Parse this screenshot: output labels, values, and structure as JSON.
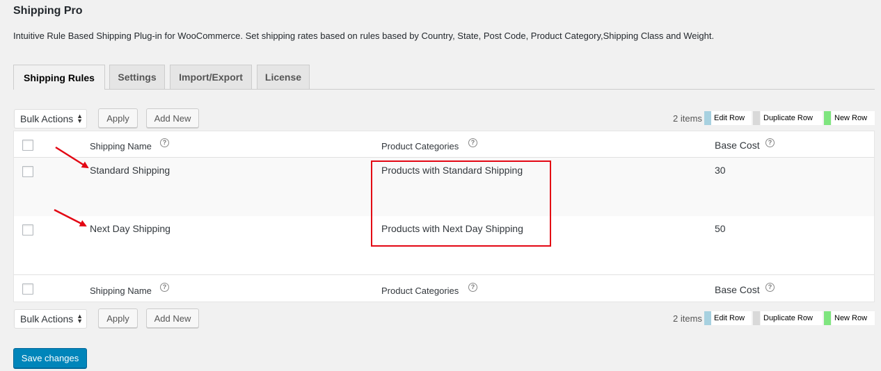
{
  "header": {
    "title": "Shipping Pro",
    "description": "Intuitive Rule Based Shipping Plug-in for WooCommerce. Set shipping rates based on rules based by Country, State, Post Code, Product Category,Shipping Class and Weight."
  },
  "tabs": [
    {
      "label": "Shipping Rules",
      "active": true
    },
    {
      "label": "Settings",
      "active": false
    },
    {
      "label": "Import/Export",
      "active": false
    },
    {
      "label": "License",
      "active": false
    }
  ],
  "toolbar_top": {
    "bulk_actions": "Bulk Actions",
    "apply_label": "Apply",
    "add_new_label": "Add New",
    "items_count": "2 items"
  },
  "toolbar_bottom": {
    "bulk_actions": "Bulk Actions",
    "apply_label": "Apply",
    "add_new_label": "Add New",
    "items_count": "2 items"
  },
  "legend": {
    "edit_row": "Edit Row",
    "duplicate_row": "Duplicate Row",
    "new_row": "New Row",
    "colors": {
      "edit": "#a7d1e0",
      "duplicate": "#d9d9d9",
      "new": "#7fe57f"
    }
  },
  "table": {
    "columns": [
      "Shipping Name",
      "Product Categories",
      "Base Cost"
    ],
    "rows": [
      {
        "shipping_name": "Standard Shipping",
        "product_categories": "Products with Standard Shipping",
        "base_cost": "30"
      },
      {
        "shipping_name": "Next Day Shipping",
        "product_categories": "Products with Next Day Shipping",
        "base_cost": "50"
      }
    ]
  },
  "save_label": "Save changes",
  "colors": {
    "primary": "#0085ba",
    "annotation": "#e30613"
  }
}
